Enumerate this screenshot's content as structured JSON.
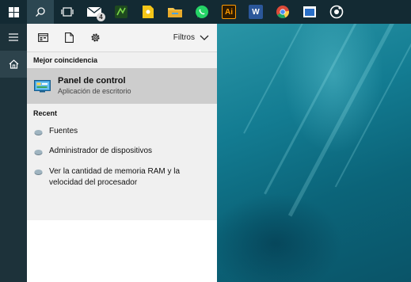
{
  "taskbar": {
    "start_icon": "windows-logo",
    "search_icon": "search-icon",
    "taskview_icon": "task-view-icon",
    "apps": [
      {
        "name": "mail-icon",
        "badge": "4",
        "color": "#ffffff"
      },
      {
        "name": "ulysses-icon",
        "color": "#3a8c2a"
      },
      {
        "name": "keep-icon",
        "color": "#f1c40f"
      },
      {
        "name": "file-explorer-icon",
        "color": "#f4c24a"
      },
      {
        "name": "whatsapp-icon",
        "color": "#25d366"
      },
      {
        "name": "illustrator-icon",
        "label": "Ai",
        "color": "#ff9a00"
      },
      {
        "name": "word-icon",
        "label": "W",
        "color": "#2b579a"
      },
      {
        "name": "chrome-icon",
        "color": "#dd4b39"
      },
      {
        "name": "window-app-icon",
        "color": "#2a6fc7"
      },
      {
        "name": "groove-icon",
        "color": "#ffffff"
      }
    ]
  },
  "rail": {
    "menu_icon": "hamburger-icon",
    "home_icon": "home-icon"
  },
  "panel": {
    "top_icons": [
      "apps-icon",
      "documents-icon",
      "settings-icon"
    ],
    "filters_label": "Filtros",
    "best_match_heading": "Mejor coincidencia",
    "best_match": {
      "title": "Panel de control",
      "subtitle": "Aplicación de escritorio"
    },
    "recent_heading": "Recent",
    "recent": [
      {
        "line1": "Fuentes"
      },
      {
        "line1": "Administrador de dispositivos"
      },
      {
        "line1": "Ver la cantidad de memoria RAM y la",
        "line2": "velocidad del procesador"
      }
    ]
  }
}
